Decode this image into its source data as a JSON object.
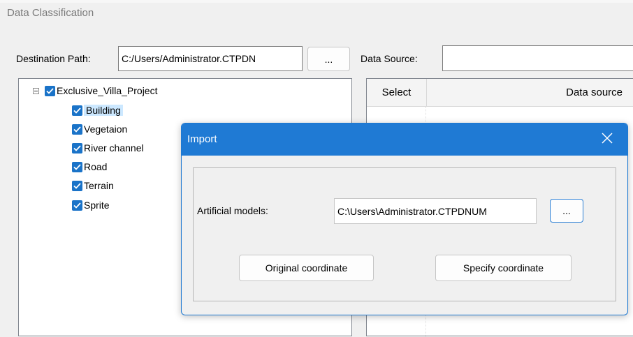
{
  "window": {
    "title": "Data Classification"
  },
  "destination": {
    "label": "Destination Path:",
    "value": "C:/Users/Administrator.CTPDN",
    "browse_label": "..."
  },
  "data_source": {
    "label": "Data Source:",
    "value": ""
  },
  "tree": {
    "root": {
      "label": "Exclusive_Villa_Project",
      "checked": true,
      "expanded": true
    },
    "children": [
      {
        "label": "Building",
        "checked": true,
        "selected": true
      },
      {
        "label": "Vegetaion",
        "checked": true
      },
      {
        "label": "River channel",
        "checked": true
      },
      {
        "label": "Road",
        "checked": true
      },
      {
        "label": "Terrain",
        "checked": true
      },
      {
        "label": "Sprite",
        "checked": true
      }
    ]
  },
  "grid": {
    "columns": [
      "Select",
      "Data source"
    ]
  },
  "import_dialog": {
    "title": "Import",
    "close_icon": "close-icon",
    "artificial_models_label": "Artificial models:",
    "artificial_models_value": "C:\\Users\\Administrator.CTPDNUM",
    "browse_label": "...",
    "original_button": "Original coordinate",
    "specify_button": "Specify coordinate"
  },
  "colors": {
    "accent": "#1f7ad4",
    "check": "#1a73c8",
    "selection": "#cce8ff"
  }
}
